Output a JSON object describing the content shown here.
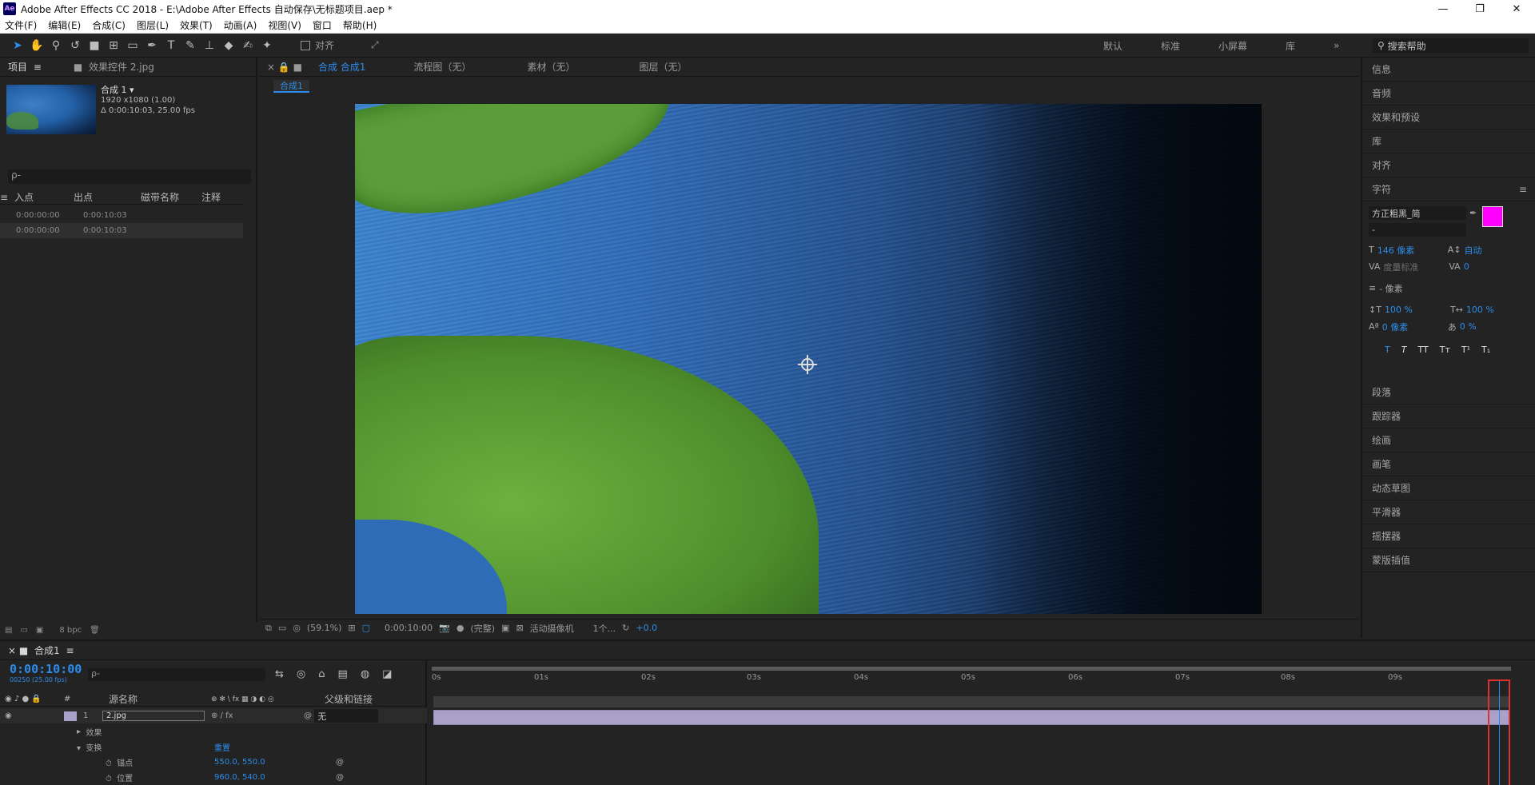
{
  "titlebar": {
    "icon": "Ae",
    "title": "Adobe After Effects CC 2018 - E:\\Adobe After Effects 自动保存\\无标题项目.aep *",
    "minimize": "—",
    "maximize": "❐",
    "close": "✕"
  },
  "menu": [
    "文件(F)",
    "编辑(E)",
    "合成(C)",
    "图层(L)",
    "效果(T)",
    "动画(A)",
    "视图(V)",
    "窗口",
    "帮助(H)"
  ],
  "toolbar": {
    "snap_label": "对齐",
    "workspaces": [
      "默认",
      "标准",
      "小屏幕",
      "库"
    ],
    "more": "»",
    "help_placeholder": "搜索帮助"
  },
  "project": {
    "tabs": [
      "项目",
      "效果控件 2.jpg"
    ],
    "comp_name": "合成 1",
    "comp_res": "1920 x1080 (1.00)",
    "comp_dur": "Δ 0:00:10:03, 25.00 fps",
    "search_icon": "ρ-",
    "headers": [
      "入点",
      "出点",
      "磁带名称",
      "注释"
    ],
    "rows": [
      {
        "in": "0:00:00:00",
        "out": "0:00:10:03"
      },
      {
        "in": "0:00:00:00",
        "out": "0:00:10:03"
      }
    ],
    "bpc": "8 bpc"
  },
  "comp": {
    "tabs": [
      "合成 合成1",
      "流程图（无）",
      "素材（无）",
      "图层（无）"
    ],
    "subtab": "合成1",
    "zoom": "(59.1%)",
    "time": "0:00:10:00",
    "quality": "(完整)",
    "camera": "活动摄像机",
    "views": "1个...",
    "exposure": "+0.0"
  },
  "right": {
    "items_top": [
      "信息",
      "音频",
      "效果和预设",
      "库",
      "对齐",
      "字符"
    ],
    "character": {
      "font": "方正粗黑_简",
      "style": "-",
      "size": "146 像素",
      "leading": "自动",
      "kerning": "度量标准",
      "tracking": "0",
      "stroke": "- 像素",
      "vscale": "100 %",
      "hscale": "100 %",
      "baseline": "0 像素",
      "tsume": "0 %",
      "styles": [
        "T",
        "T",
        "TT",
        "Tт",
        "T¹",
        "T₁"
      ],
      "fill_color": "#ff00ff"
    },
    "items_bottom": [
      "段落",
      "跟踪器",
      "绘画",
      "画笔",
      "动态草图",
      "平滑器",
      "摇摆器",
      "蒙版插值"
    ]
  },
  "timeline": {
    "tab": "合成1",
    "time": "0:00:10:00",
    "frames": "00250 (25.00 fps)",
    "search_icon": "ρ-",
    "headers": [
      "#",
      "源名称",
      "父级和链接"
    ],
    "layer": {
      "index": "1",
      "name": "2.jpg",
      "parent": "无"
    },
    "rows": [
      {
        "label": "效果"
      },
      {
        "label": "变换",
        "value": "重置"
      },
      {
        "label": "锚点",
        "value": "550.0, 550.0"
      },
      {
        "label": "位置",
        "value": "960.0, 540.0"
      }
    ],
    "ruler": [
      "0s",
      "01s",
      "02s",
      "03s",
      "04s",
      "05s",
      "06s",
      "07s",
      "08s",
      "09s"
    ],
    "playhead_fraction": 0.99
  }
}
